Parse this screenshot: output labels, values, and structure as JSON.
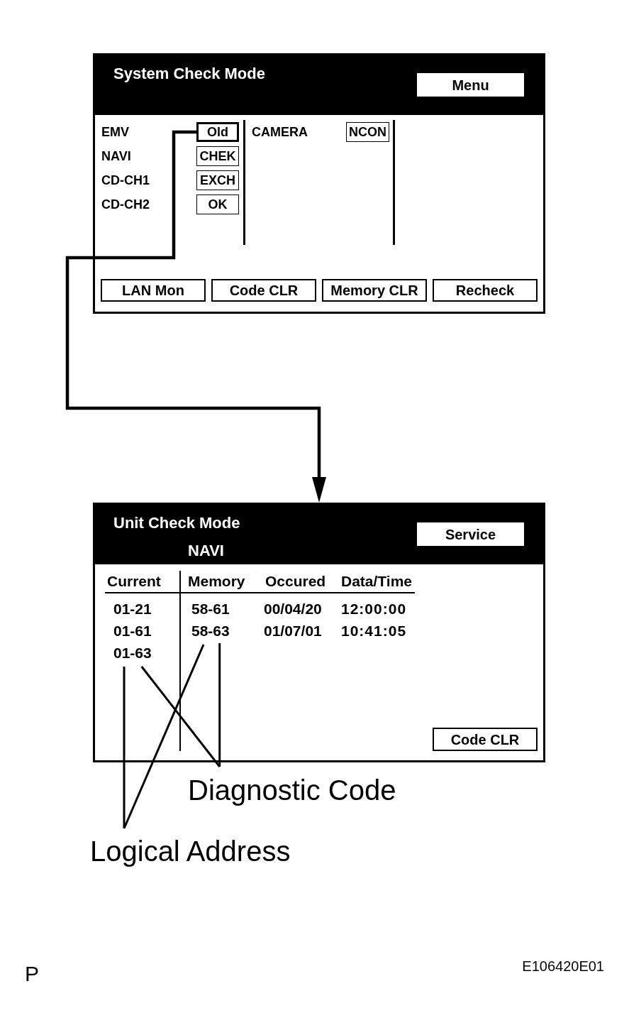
{
  "system_check_screen": {
    "title": "System Check Mode",
    "menu_button": "Menu",
    "unit_columns": [
      {
        "units": [
          {
            "name": "EMV",
            "status": "Old",
            "kind": "emphasized"
          },
          {
            "name": "NAVI",
            "status": "CHEK",
            "kind": "plain"
          },
          {
            "name": "CD-CH1",
            "status": "EXCH",
            "kind": "plain"
          },
          {
            "name": "CD-CH2",
            "status": "OK",
            "kind": "plain"
          }
        ]
      },
      {
        "units": [
          {
            "name": "CAMERA",
            "status": "NCON",
            "kind": "plain"
          }
        ]
      }
    ],
    "buttons": [
      "LAN Mon",
      "Code CLR",
      "Memory CLR",
      "Recheck"
    ]
  },
  "unit_check_screen": {
    "title": "Unit Check Mode",
    "unit": "NAVI",
    "service_button": "Service",
    "table": {
      "columns": [
        "Current",
        "Memory",
        "Occured",
        "Data/Time"
      ],
      "rows": [
        {
          "cells": [
            "01-21",
            "58-61",
            "00/04/20",
            "12:00:00"
          ]
        },
        {
          "cells": [
            "01-61",
            "58-63",
            "01/07/01",
            "10:41:05"
          ]
        },
        {
          "cells": [
            "01-63"
          ]
        }
      ]
    },
    "code_clr_button": "Code CLR"
  },
  "callouts": [
    {
      "kind": "diagnostic_code",
      "label": "Diagnostic Code"
    },
    {
      "kind": "logical_address",
      "label": "Logical Address"
    }
  ],
  "page_mark": "P",
  "figure_code": "E106420E01"
}
